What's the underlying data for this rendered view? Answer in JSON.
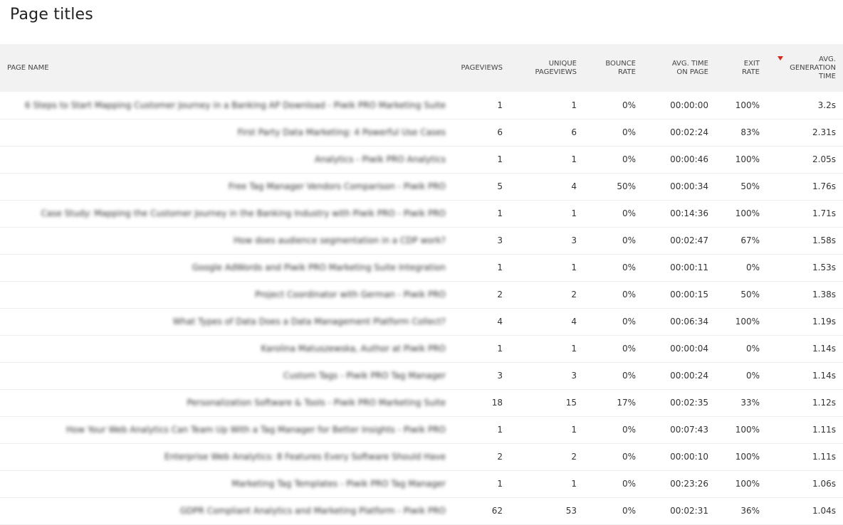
{
  "page": {
    "title": "Page titles"
  },
  "columns": {
    "page_name": "PAGE NAME",
    "pageviews": "PAGEVIEWS",
    "unique_pageviews": "UNIQUE PAGEVIEWS",
    "bounce_rate": "BOUNCE RATE",
    "avg_time_on_page": "AVG. TIME ON PAGE",
    "exit_rate": "EXIT RATE",
    "avg_generation_time": "AVG. GENERATION TIME"
  },
  "sort": {
    "column": "avg_generation_time",
    "direction": "descending",
    "indicator_color": "#d4291f"
  },
  "rows": [
    {
      "name": "6 Steps to Start Mapping Customer Journey in a Banking AP Download - Piwik PRO Marketing Suite",
      "pageviews": "1",
      "unique_pageviews": "1",
      "bounce_rate": "0%",
      "avg_time_on_page": "00:00:00",
      "exit_rate": "100%",
      "avg_generation_time": "3.2s"
    },
    {
      "name": "First Party Data Marketing: 4 Powerful Use Cases",
      "pageviews": "6",
      "unique_pageviews": "6",
      "bounce_rate": "0%",
      "avg_time_on_page": "00:02:24",
      "exit_rate": "83%",
      "avg_generation_time": "2.31s"
    },
    {
      "name": "Analytics - Piwik PRO Analytics",
      "pageviews": "1",
      "unique_pageviews": "1",
      "bounce_rate": "0%",
      "avg_time_on_page": "00:00:46",
      "exit_rate": "100%",
      "avg_generation_time": "2.05s"
    },
    {
      "name": "Free Tag Manager Vendors Comparison - Piwik PRO",
      "pageviews": "5",
      "unique_pageviews": "4",
      "bounce_rate": "50%",
      "avg_time_on_page": "00:00:34",
      "exit_rate": "50%",
      "avg_generation_time": "1.76s"
    },
    {
      "name": "Case Study: Mapping the Customer Journey in the Banking Industry with Piwik PRO - Piwik PRO",
      "pageviews": "1",
      "unique_pageviews": "1",
      "bounce_rate": "0%",
      "avg_time_on_page": "00:14:36",
      "exit_rate": "100%",
      "avg_generation_time": "1.71s"
    },
    {
      "name": "How does audience segmentation in a CDP work?",
      "pageviews": "3",
      "unique_pageviews": "3",
      "bounce_rate": "0%",
      "avg_time_on_page": "00:02:47",
      "exit_rate": "67%",
      "avg_generation_time": "1.58s"
    },
    {
      "name": "Google AdWords and Piwik PRO Marketing Suite Integration",
      "pageviews": "1",
      "unique_pageviews": "1",
      "bounce_rate": "0%",
      "avg_time_on_page": "00:00:11",
      "exit_rate": "0%",
      "avg_generation_time": "1.53s"
    },
    {
      "name": "Project Coordinator with German - Piwik PRO",
      "pageviews": "2",
      "unique_pageviews": "2",
      "bounce_rate": "0%",
      "avg_time_on_page": "00:00:15",
      "exit_rate": "50%",
      "avg_generation_time": "1.38s"
    },
    {
      "name": "What Types of Data Does a Data Management Platform Collect?",
      "pageviews": "4",
      "unique_pageviews": "4",
      "bounce_rate": "0%",
      "avg_time_on_page": "00:06:34",
      "exit_rate": "100%",
      "avg_generation_time": "1.19s"
    },
    {
      "name": "Karolina Matuszewska, Author at Piwik PRO",
      "pageviews": "1",
      "unique_pageviews": "1",
      "bounce_rate": "0%",
      "avg_time_on_page": "00:00:04",
      "exit_rate": "0%",
      "avg_generation_time": "1.14s"
    },
    {
      "name": "Custom Tags - Piwik PRO Tag Manager",
      "pageviews": "3",
      "unique_pageviews": "3",
      "bounce_rate": "0%",
      "avg_time_on_page": "00:00:24",
      "exit_rate": "0%",
      "avg_generation_time": "1.14s"
    },
    {
      "name": "Personalization Software & Tools - Piwik PRO Marketing Suite",
      "pageviews": "18",
      "unique_pageviews": "15",
      "bounce_rate": "17%",
      "avg_time_on_page": "00:02:35",
      "exit_rate": "33%",
      "avg_generation_time": "1.12s"
    },
    {
      "name": "How Your Web Analytics Can Team Up With a Tag Manager for Better Insights - Piwik PRO",
      "pageviews": "1",
      "unique_pageviews": "1",
      "bounce_rate": "0%",
      "avg_time_on_page": "00:07:43",
      "exit_rate": "100%",
      "avg_generation_time": "1.11s"
    },
    {
      "name": "Enterprise Web Analytics: 8 Features Every Software Should Have",
      "pageviews": "2",
      "unique_pageviews": "2",
      "bounce_rate": "0%",
      "avg_time_on_page": "00:00:10",
      "exit_rate": "100%",
      "avg_generation_time": "1.11s"
    },
    {
      "name": "Marketing Tag Templates - Piwik PRO Tag Manager",
      "pageviews": "1",
      "unique_pageviews": "1",
      "bounce_rate": "0%",
      "avg_time_on_page": "00:23:26",
      "exit_rate": "100%",
      "avg_generation_time": "1.06s"
    },
    {
      "name": "GDPR Compliant Analytics and Marketing Platform - Piwik PRO",
      "pageviews": "62",
      "unique_pageviews": "53",
      "bounce_rate": "0%",
      "avg_time_on_page": "00:02:31",
      "exit_rate": "36%",
      "avg_generation_time": "1.04s"
    }
  ]
}
